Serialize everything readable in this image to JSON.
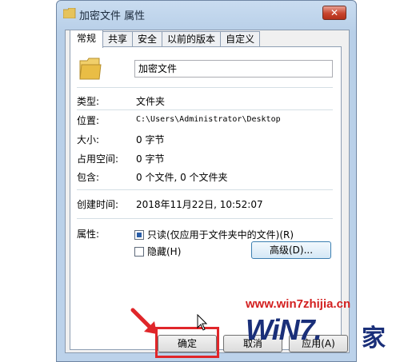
{
  "window": {
    "title": "加密文件 属性",
    "close_glyph": "✕"
  },
  "tabs": [
    {
      "label": "常规",
      "active": true
    },
    {
      "label": "共享",
      "active": false
    },
    {
      "label": "安全",
      "active": false
    },
    {
      "label": "以前的版本",
      "active": false
    },
    {
      "label": "自定义",
      "active": false
    }
  ],
  "general": {
    "folder_name": "加密文件",
    "type_label": "类型:",
    "type_value": "文件夹",
    "location_label": "位置:",
    "location_value": "C:\\Users\\Administrator\\Desktop",
    "size_label": "大小:",
    "size_value": "0 字节",
    "disk_label": "占用空间:",
    "disk_value": "0 字节",
    "contains_label": "包含:",
    "contains_value": "0 个文件, 0 个文件夹",
    "created_label": "创建时间:",
    "created_value": "2018年11月22日, 10:52:07",
    "attributes_label": "属性:",
    "readonly_label": "只读(仅应用于文件夹中的文件)(R)",
    "readonly_checked": true,
    "hidden_label": "隐藏(H)",
    "hidden_checked": false,
    "advanced_button": "高级(D)..."
  },
  "buttons": {
    "ok": "确定",
    "cancel": "取消",
    "apply": "应用(A)"
  },
  "watermark": {
    "url": "www.win7zhijia.cn",
    "logo": "WiN7.",
    "suffix": "家"
  },
  "colors": {
    "highlight": "#e0262a",
    "watermark_url": "#d31f1f",
    "watermark_logo": "#1a2f79"
  }
}
